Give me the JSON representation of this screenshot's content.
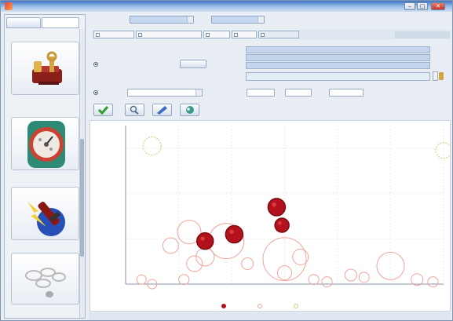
{
  "window": {
    "title": "",
    "minimize_glyph": "–",
    "maximize_glyph": "□",
    "close_glyph": "✕"
  },
  "left_panel": {
    "tabs": [
      {
        "label": ""
      },
      {
        "label": ""
      }
    ],
    "items": [
      {
        "caption": "",
        "icon": "tools-icon"
      },
      {
        "caption": "",
        "icon": "gauge-icon"
      },
      {
        "caption": "",
        "icon": "warning-icon"
      },
      {
        "caption": "",
        "icon": "bubbles-icon"
      }
    ]
  },
  "toolbar": {
    "field1_label": "",
    "field1_value": "",
    "field2_label": "",
    "field2_value": ""
  },
  "plot_tabs": [
    {
      "label": ""
    },
    {
      "label": ""
    },
    {
      "label": ""
    },
    {
      "label": ""
    },
    {
      "label": ""
    }
  ],
  "options": {
    "radio1_label": "",
    "button_label": "",
    "radio2_label": "",
    "select_value": "",
    "field3_label": "",
    "field4_label": "",
    "field5_label": ""
  },
  "info": {
    "rows": [
      {
        "label": "",
        "value": ""
      },
      {
        "label": "",
        "value": ""
      },
      {
        "label": "",
        "value": ""
      },
      {
        "label": "",
        "value": ""
      }
    ]
  },
  "action_buttons": [
    {
      "icon": "check-icon",
      "color": "#2f9d2f"
    },
    {
      "icon": "zoom-icon",
      "color": "#556b8a"
    },
    {
      "icon": "pencil-icon",
      "color": "#3b6fc4"
    },
    {
      "icon": "globe-icon",
      "color": "#3a9a8a"
    }
  ],
  "colors": {
    "title_bar": "#3d72c4",
    "bubble_dark": "#b3121c",
    "bubble_outline": "#f0a49c",
    "bubble_yellow": "#c9cf75",
    "grid": "#e7ebf0"
  },
  "chart_data": {
    "type": "scatter",
    "title": "",
    "xlabel": "",
    "ylabel": "",
    "xlim": [
      0,
      12
    ],
    "ylim": [
      0,
      7
    ],
    "x_ticks": [
      "",
      "",
      "",
      "",
      "",
      "",
      ""
    ],
    "y_ticks": [
      "",
      "",
      ""
    ],
    "grid": true,
    "legend_position": "bottom",
    "series": [
      {
        "name": "",
        "color": "#b3121c",
        "style": "filled",
        "points": [
          {
            "x": 5.7,
            "y": 3.4,
            "r": 2.2
          },
          {
            "x": 5.9,
            "y": 2.6,
            "r": 1.8
          },
          {
            "x": 4.1,
            "y": 2.2,
            "r": 2.2
          },
          {
            "x": 3.0,
            "y": 1.9,
            "r": 2.1
          }
        ]
      },
      {
        "name": "",
        "color": "#f0a49c",
        "style": "outline",
        "points": [
          {
            "x": 2.4,
            "y": 2.3,
            "r": 3.0
          },
          {
            "x": 3.8,
            "y": 1.9,
            "r": 4.5
          },
          {
            "x": 1.7,
            "y": 1.7,
            "r": 2.0
          },
          {
            "x": 3.0,
            "y": 1.2,
            "r": 2.3
          },
          {
            "x": 2.6,
            "y": 0.9,
            "r": 2.0
          },
          {
            "x": 2.2,
            "y": 0.2,
            "r": 1.3
          },
          {
            "x": 0.6,
            "y": 0.2,
            "r": 1.2
          },
          {
            "x": 1.0,
            "y": 0.0,
            "r": 1.2
          },
          {
            "x": 6.0,
            "y": 1.1,
            "r": 5.5
          },
          {
            "x": 6.6,
            "y": 1.2,
            "r": 2.0
          },
          {
            "x": 6.0,
            "y": 0.5,
            "r": 1.8
          },
          {
            "x": 4.6,
            "y": 0.9,
            "r": 1.5
          },
          {
            "x": 7.1,
            "y": 0.2,
            "r": 1.3
          },
          {
            "x": 7.6,
            "y": 0.1,
            "r": 1.3
          },
          {
            "x": 8.5,
            "y": 0.4,
            "r": 1.5
          },
          {
            "x": 9.0,
            "y": 0.3,
            "r": 1.3
          },
          {
            "x": 11.0,
            "y": 0.2,
            "r": 1.5
          },
          {
            "x": 11.6,
            "y": 0.1,
            "r": 1.3
          },
          {
            "x": 10.0,
            "y": 0.8,
            "r": 3.5
          }
        ]
      },
      {
        "name": "",
        "color": "#c9cf75",
        "style": "outline",
        "points": [
          {
            "x": 1.0,
            "y": 6.1,
            "r": 2.3
          },
          {
            "x": 12.0,
            "y": 5.9,
            "r": 2.0
          }
        ]
      }
    ]
  }
}
